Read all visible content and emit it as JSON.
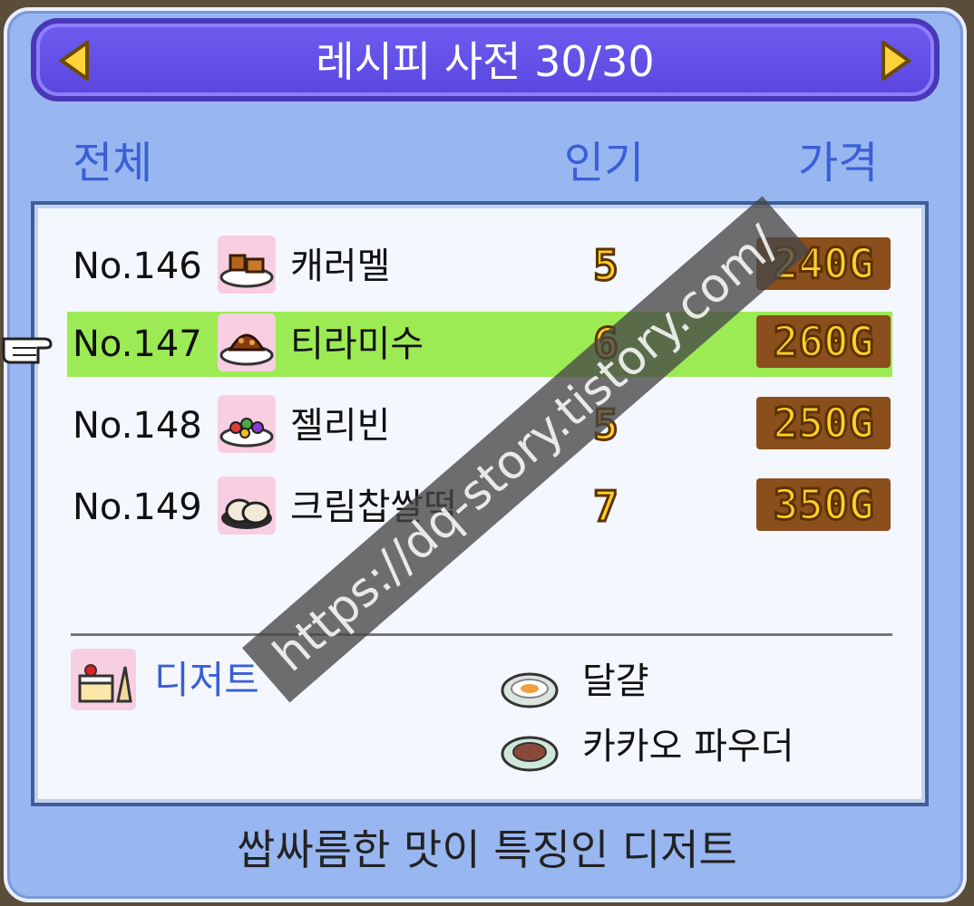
{
  "header": {
    "title": "레시피 사전 30/30"
  },
  "tabs": {
    "all": "전체",
    "popularity": "인기",
    "price": "가격"
  },
  "recipes": [
    {
      "no": "No.146",
      "name": "캐러멜",
      "icon": "caramel-icon",
      "popularity": "5",
      "price": "240G",
      "selected": false
    },
    {
      "no": "No.147",
      "name": "티라미수",
      "icon": "tiramisu-icon",
      "popularity": "6",
      "price": "260G",
      "selected": true
    },
    {
      "no": "No.148",
      "name": "젤리빈",
      "icon": "jellybean-icon",
      "popularity": "5",
      "price": "250G",
      "selected": false
    },
    {
      "no": "No.149",
      "name": "크림찹쌀떡",
      "icon": "cream-mochi-icon",
      "popularity": "7",
      "price": "350G",
      "selected": false
    }
  ],
  "category": {
    "label": "디저트",
    "icon": "dessert-icon"
  },
  "ingredients": [
    {
      "name": "달걀",
      "icon": "egg-dish-icon"
    },
    {
      "name": "카카오 파우더",
      "icon": "cacao-powder-icon"
    }
  ],
  "description": "쌉싸름한 맛이 특징인 디저트",
  "watermark": "https://dq-story.tistory.com/",
  "colors": {
    "frame": "#98b6f0",
    "title_bar": "#5e4ce4",
    "tab_text": "#3a5fd6",
    "selected_row": "#9deb54",
    "number_gold": "#ffd02a"
  }
}
